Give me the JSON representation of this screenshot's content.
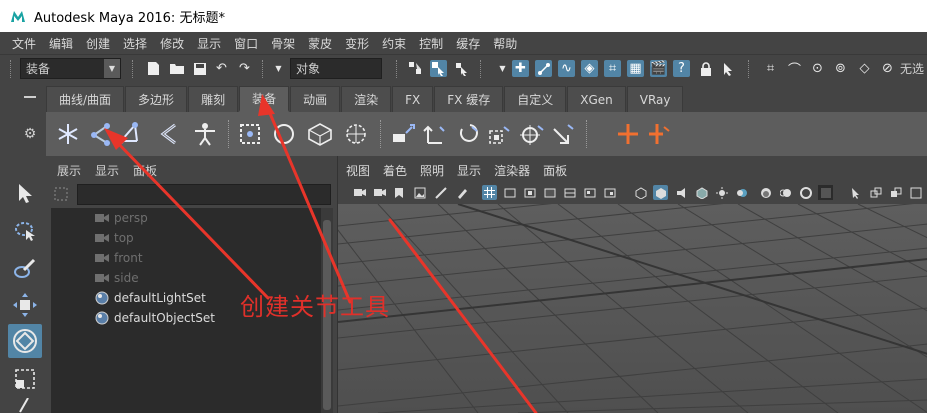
{
  "window": {
    "title": "Autodesk Maya 2016: 无标题*"
  },
  "menubar": {
    "items": [
      "文件",
      "编辑",
      "创建",
      "选择",
      "修改",
      "显示",
      "窗口",
      "骨架",
      "蒙皮",
      "变形",
      "约束",
      "控制",
      "缓存",
      "帮助"
    ]
  },
  "statusline": {
    "menuset_value": "装备",
    "object_field_value": "对象",
    "right_text": "无选"
  },
  "shelf": {
    "tabs": [
      "曲线/曲面",
      "多边形",
      "雕刻",
      "装备",
      "动画",
      "渲染",
      "FX",
      "FX 缓存",
      "自定义",
      "XGen",
      "VRay"
    ],
    "active_tab": "装备"
  },
  "outliner": {
    "menu": [
      "展示",
      "显示",
      "面板"
    ],
    "items": [
      {
        "label": "persp",
        "kind": "camera"
      },
      {
        "label": "top",
        "kind": "camera"
      },
      {
        "label": "front",
        "kind": "camera"
      },
      {
        "label": "side",
        "kind": "camera"
      },
      {
        "label": "defaultLightSet",
        "kind": "set"
      },
      {
        "label": "defaultObjectSet",
        "kind": "set"
      }
    ]
  },
  "viewport": {
    "menu": [
      "视图",
      "着色",
      "照明",
      "显示",
      "渲染器",
      "面板"
    ]
  },
  "annotation": {
    "text": "创建关节工具",
    "color": "#e0302a"
  },
  "colors": {
    "accent": "#5285a6",
    "shelf_bg": "#5d5d5d",
    "panel_bg": "#444444",
    "field_bg": "#2b2b2b"
  }
}
